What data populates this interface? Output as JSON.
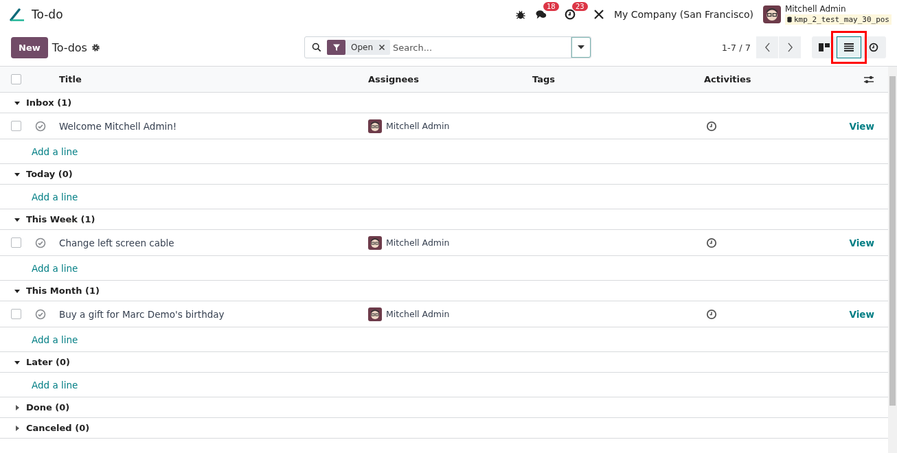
{
  "navbar": {
    "app_name": "To-do",
    "messages_badge": "18",
    "activities_badge": "23",
    "company": "My Company (San Francisco)",
    "user_name": "Mitchell Admin",
    "database": "kmp_2_test_may_30_pos"
  },
  "control_panel": {
    "new_button": "New",
    "title": "To-dos",
    "facet": {
      "label": "Open"
    },
    "search": {
      "placeholder": "Search..."
    },
    "pager": "1-7 / 7",
    "views": [
      {
        "kind": "kanban",
        "selected": false,
        "highlighted": false
      },
      {
        "kind": "list",
        "selected": true,
        "highlighted": true
      },
      {
        "kind": "activity",
        "selected": false,
        "highlighted": false
      }
    ]
  },
  "table": {
    "select_all_checked": false,
    "columns": [
      "Title",
      "Assignees",
      "Tags",
      "Activities"
    ],
    "groups": [
      {
        "label": "Inbox (1)",
        "expanded": true,
        "add_line": "Add a line",
        "records": [
          {
            "title": "Welcome Mitchell Admin!",
            "assignee": "Mitchell Admin",
            "action": "View",
            "checked": false
          }
        ]
      },
      {
        "label": "Today (0)",
        "expanded": true,
        "add_line": "Add a line"
      },
      {
        "label": "This Week (1)",
        "expanded": true,
        "add_line": "Add a line",
        "records": [
          {
            "title": "Change left screen cable",
            "assignee": "Mitchell Admin",
            "action": "View",
            "checked": false
          }
        ]
      },
      {
        "label": "This Month (1)",
        "expanded": true,
        "add_line": "Add a line",
        "records": [
          {
            "title": "Buy a gift for Marc Demo's birthday",
            "assignee": "Mitchell Admin",
            "action": "View",
            "checked": false
          }
        ]
      },
      {
        "label": "Later (0)",
        "expanded": true,
        "add_line": "Add a line"
      },
      {
        "label": "Done (0)",
        "expanded": false
      },
      {
        "label": "Canceled (0)",
        "expanded": false
      }
    ]
  }
}
